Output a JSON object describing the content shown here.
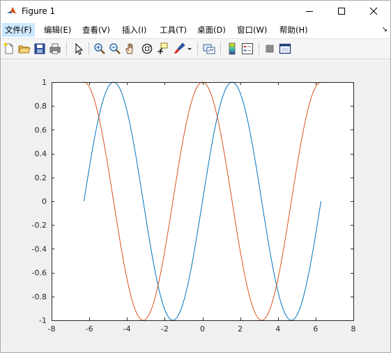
{
  "window": {
    "title": "Figure 1"
  },
  "menu": {
    "items": [
      {
        "label": "文件(F)"
      },
      {
        "label": "编辑(E)"
      },
      {
        "label": "查看(V)"
      },
      {
        "label": "插入(I)"
      },
      {
        "label": "工具(T)"
      },
      {
        "label": "桌面(D)"
      },
      {
        "label": "窗口(W)"
      },
      {
        "label": "帮助(H)"
      }
    ],
    "overflow_icon": "dock-arrow-icon"
  },
  "toolbar": {
    "buttons": [
      "new-figure-icon",
      "open-file-icon",
      "save-icon",
      "print-icon",
      "edit-plot-arrow-icon",
      "zoom-in-icon",
      "zoom-out-icon",
      "pan-hand-icon",
      "rotate-3d-icon",
      "data-cursor-icon",
      "brush-icon",
      "link-plot-icon",
      "colorbar-icon",
      "legend-icon",
      "hide-plot-tools-icon",
      "show-plot-tools-icon"
    ]
  },
  "colors": {
    "series1": "#0072bd",
    "series2": "#d95319",
    "axes_bg": "#ffffff",
    "figure_bg": "#f0f0f0"
  },
  "chart_data": {
    "type": "line",
    "xlim": [
      -8,
      8
    ],
    "ylim": [
      -1,
      1
    ],
    "xticks": [
      -8,
      -6,
      -4,
      -2,
      0,
      2,
      4,
      6,
      8
    ],
    "yticks": [
      -1,
      -0.8,
      -0.6,
      -0.4,
      -0.2,
      0,
      0.2,
      0.4,
      0.6,
      0.8,
      1
    ],
    "xtick_labels": [
      "-8",
      "-6",
      "-4",
      "-2",
      "0",
      "2",
      "4",
      "6",
      "8"
    ],
    "ytick_labels": [
      "-1",
      "-0.8",
      "-0.6",
      "-0.4",
      "-0.2",
      "0",
      "0.2",
      "0.4",
      "0.6",
      "0.8",
      "1"
    ],
    "grid": false,
    "x_domain": [
      -6.2832,
      6.2832
    ],
    "series": [
      {
        "function": "sin(x)",
        "color": "#0072bd"
      },
      {
        "function": "cos(x)",
        "color": "#d95319"
      }
    ]
  }
}
